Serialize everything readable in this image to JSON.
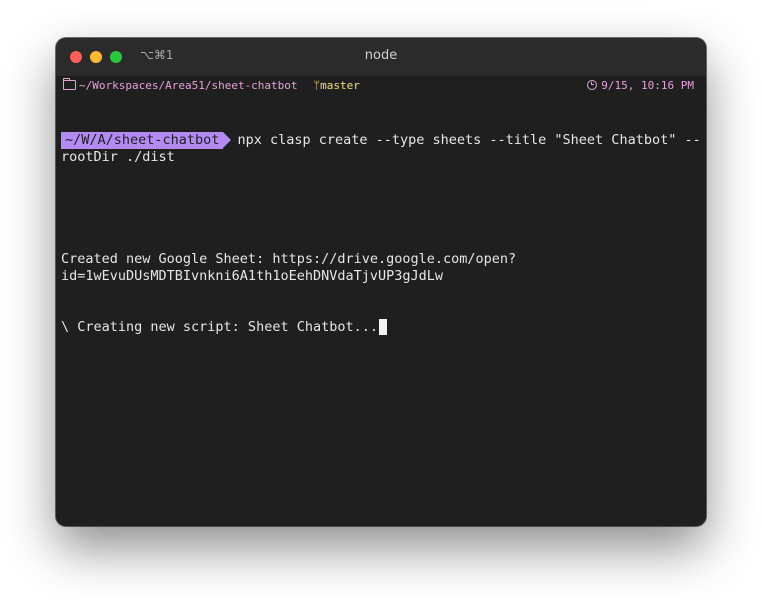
{
  "window": {
    "shortcut": "⌥⌘1",
    "title": "node"
  },
  "status": {
    "path": "~/Workspaces/Area51/sheet-chatbot",
    "branch_icon": "git-branch-icon",
    "branch": "master",
    "datetime": "9/15, 10:16 PM"
  },
  "prompt": {
    "dir": "~/W/A/sheet-chatbot",
    "command": "npx clasp create --type sheets --title \"Sheet Chatbot\" --rootDir ./dist"
  },
  "output": {
    "line1": "Created new Google Sheet: https://drive.google.com/open?id=1wEvuDUsMDTBIvnkni6A1th1oEehDNVdaTjvUP3gJdLw",
    "line2": "\\ Creating new script: Sheet Chatbot..."
  },
  "colors": {
    "close": "#ff5f57",
    "minimize": "#febc2e",
    "maximize": "#28c840",
    "prompt_bg": "#b48af5",
    "status_text": "#e8a0d8",
    "branch_text": "#f2e27a",
    "terminal_bg": "#1f1f1f"
  }
}
